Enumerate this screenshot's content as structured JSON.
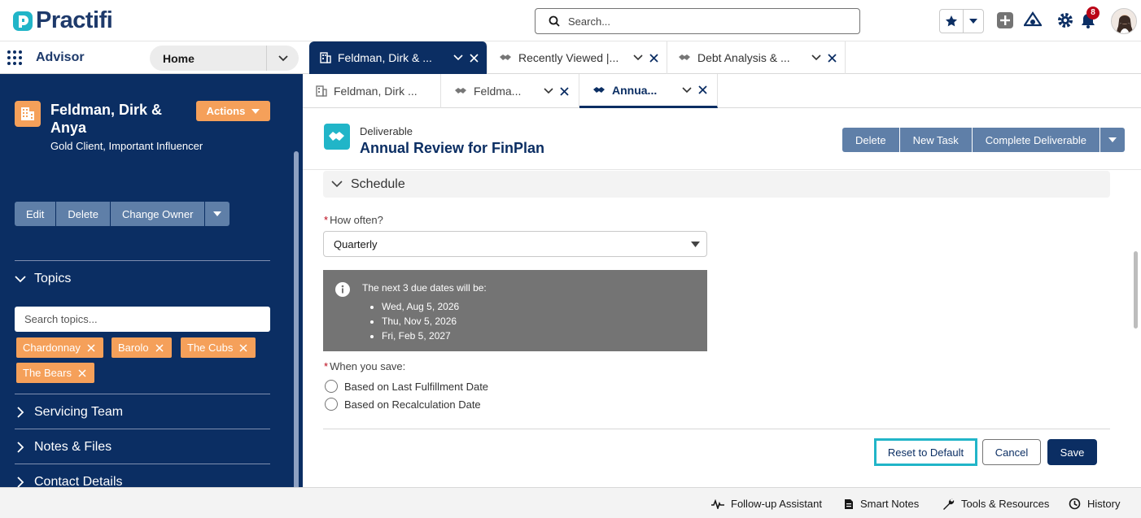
{
  "header": {
    "logo_text": "Practifi",
    "search_placeholder": "Search...",
    "notification_count": "8"
  },
  "nav": {
    "app_name": "Advisor",
    "home_label": "Home",
    "workspace_tabs": [
      {
        "label": "Feldman, Dirk & ...",
        "icon": "building-icon",
        "active": true
      },
      {
        "label": "Recently Viewed |...",
        "icon": "handshake-icon",
        "active": false
      },
      {
        "label": "Debt Analysis & ...",
        "icon": "handshake-icon",
        "active": false
      }
    ],
    "sub_tabs": [
      {
        "label": "Feldman, Dirk ...",
        "icon": "building-icon",
        "active": false
      },
      {
        "label": "Feldma...",
        "icon": "handshake-icon",
        "active": false
      },
      {
        "label": "Annua...",
        "icon": "handshake-icon",
        "active": true
      }
    ]
  },
  "left_panel": {
    "record_name": "Feldman, Dirk & Anya",
    "record_subtitle": "Gold Client, Important Influencer",
    "actions_label": "Actions",
    "buttons": [
      "Edit",
      "Delete",
      "Change Owner"
    ],
    "topics_title": "Topics",
    "topics_search_placeholder": "Search topics...",
    "topics": [
      "Chardonnay",
      "Barolo",
      "The Cubs",
      "The Bears"
    ],
    "sections": [
      "Servicing Team",
      "Notes & Files",
      "Contact Details"
    ]
  },
  "record": {
    "object_type": "Deliverable",
    "title": "Annual Review for FinPlan",
    "buttons": [
      "Delete",
      "New Task",
      "Complete Deliverable"
    ]
  },
  "form": {
    "section_title": "Schedule",
    "how_often_label": "How often?",
    "how_often_value": "Quarterly",
    "info_title": "The next 3 due dates will be:",
    "due_dates": [
      "Wed, Aug 5, 2026",
      "Thu, Nov 5, 2026",
      "Fri, Feb 5, 2027"
    ],
    "when_save_label": "When you save:",
    "radio_options": [
      "Based on Last Fulfillment Date",
      "Based on Recalculation Date"
    ],
    "reset_label": "Reset to Default",
    "cancel_label": "Cancel",
    "save_label": "Save"
  },
  "footer": {
    "items": [
      {
        "label": "Follow-up Assistant",
        "icon": "pulse-icon"
      },
      {
        "label": "Smart Notes",
        "icon": "note-icon"
      },
      {
        "label": "Tools & Resources",
        "icon": "wrench-icon"
      },
      {
        "label": "History",
        "icon": "clock-icon"
      }
    ]
  },
  "colors": {
    "brand_navy": "#0b2e63",
    "accent_orange": "#f5a05a",
    "accent_teal": "#21b5c8",
    "button_slate": "#5f7fa8"
  }
}
